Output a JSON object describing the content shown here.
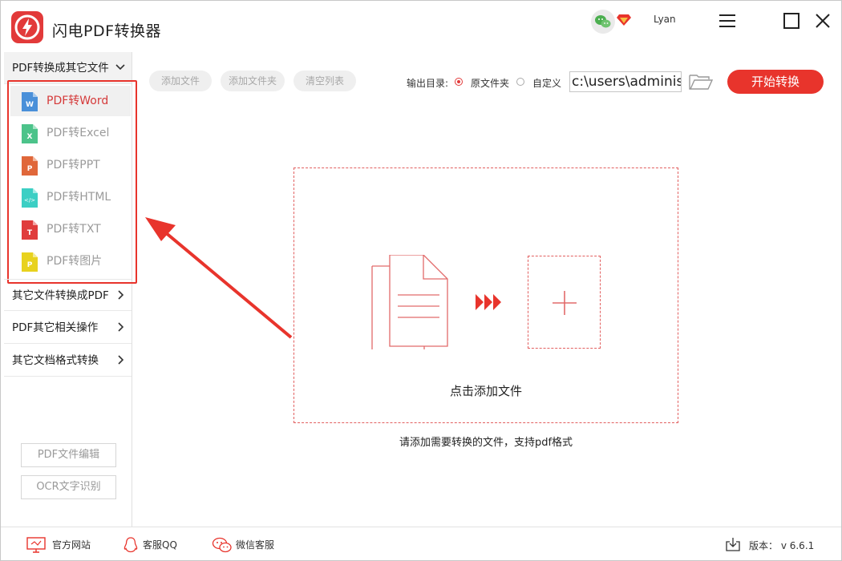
{
  "app": {
    "title": "闪电PDF转换器",
    "username": "Lyan",
    "accent_color": "#e8342c",
    "icons": [
      "lightning-logo-icon",
      "wechat-icon",
      "vip-diamond-icon",
      "menu-icon",
      "maximize-icon",
      "close-icon"
    ]
  },
  "sidebar": {
    "group1": {
      "label": "PDF转换成其它文件",
      "expanded": true
    },
    "items": [
      {
        "label": "PDF转Word",
        "icon": "word-file-icon",
        "selected": true
      },
      {
        "label": "PDF转Excel",
        "icon": "excel-file-icon",
        "selected": false
      },
      {
        "label": "PDF转PPT",
        "icon": "ppt-file-icon",
        "selected": false
      },
      {
        "label": "PDF转HTML",
        "icon": "html-file-icon",
        "selected": false
      },
      {
        "label": "PDF转TXT",
        "icon": "txt-file-icon",
        "selected": false
      },
      {
        "label": "PDF转图片",
        "icon": "image-file-icon",
        "selected": false
      }
    ],
    "group2": {
      "label": "其它文件转换成PDF"
    },
    "group3": {
      "label": "PDF其它相关操作"
    },
    "group4": {
      "label": "其它文档格式转换"
    },
    "edit_button": "PDF文件编辑",
    "ocr_button": "OCR文字识别"
  },
  "toolbar": {
    "add_file": "添加文件",
    "add_folder": "添加文件夹",
    "clear_list": "清空列表",
    "output_label": "输出目录:",
    "option_original": "原文件夹",
    "option_custom": "自定义",
    "selected_option": "原文件夹",
    "output_path": "c:\\users\\administ",
    "start": "开始转换"
  },
  "dropzone": {
    "text": "点击添加文件",
    "hint": "请添加需要转换的文件，支持pdf格式"
  },
  "footer": {
    "website": "官方网站",
    "qq": "客服QQ",
    "wechat": "微信客服",
    "version": "版本： v 6.6.1"
  }
}
